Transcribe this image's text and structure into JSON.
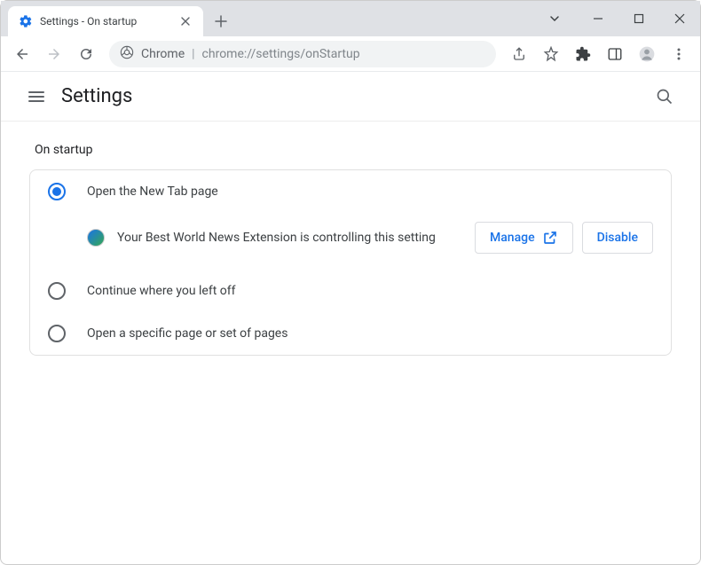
{
  "window": {
    "tab_title": "Settings - On startup"
  },
  "omnibox": {
    "scheme_label": "Chrome",
    "url_path": "chrome://settings/onStartup"
  },
  "header": {
    "title": "Settings"
  },
  "section": {
    "title": "On startup"
  },
  "options": {
    "open_new_tab": "Open the New Tab page",
    "continue": "Continue where you left off",
    "specific": "Open a specific page or set of pages"
  },
  "extension_notice": {
    "text": "Your Best World News Extension is controlling this setting",
    "manage_label": "Manage",
    "disable_label": "Disable"
  }
}
